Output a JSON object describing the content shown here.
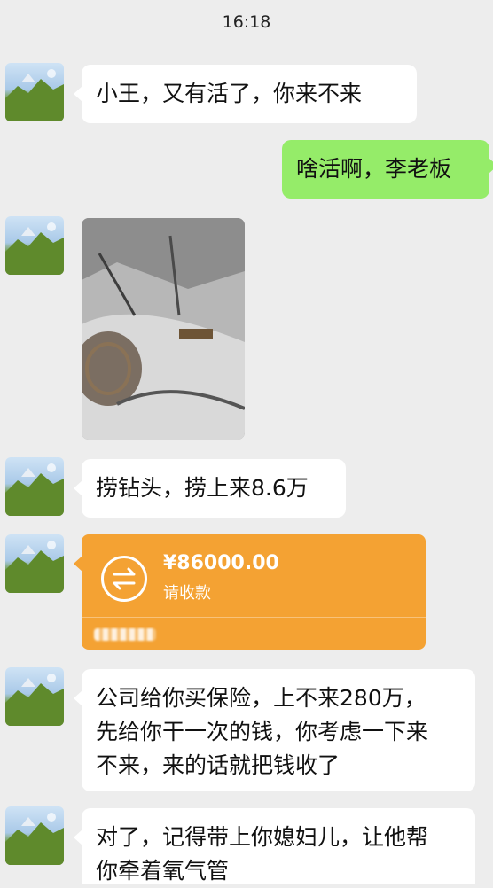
{
  "status_bar": {
    "time": "16:18"
  },
  "messages": [
    {
      "side": "left",
      "type": "text",
      "text": "小王，又有活了，你来不来"
    },
    {
      "side": "right",
      "type": "text",
      "text": "啥活啊，李老板"
    },
    {
      "side": "left",
      "type": "image"
    },
    {
      "side": "left",
      "type": "text",
      "text": "捞钻头，捞上来8.6万"
    },
    {
      "side": "left",
      "type": "transfer",
      "amount": "¥86000.00",
      "status": "请收款"
    },
    {
      "side": "left",
      "type": "text",
      "lines": [
        "公司给你买保险，上不来280万，",
        "先给你干一次的钱，你考虑一下来",
        "不来，来的话就把钱收了"
      ]
    },
    {
      "side": "left",
      "type": "text",
      "lines": [
        "对了，记得带上你媳妇儿，让他帮",
        "你牵着氧气管"
      ]
    }
  ],
  "colors": {
    "background": "#ededed",
    "incoming_bubble": "#ffffff",
    "outgoing_bubble": "#95ec69",
    "transfer_card": "#f4a233"
  },
  "icons": {
    "transfer": "transfer-arrows-icon"
  }
}
